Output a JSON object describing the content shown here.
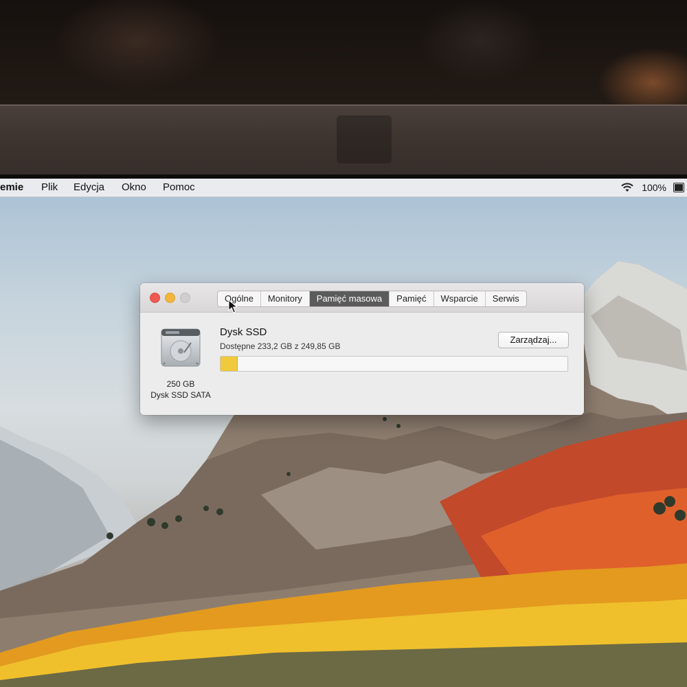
{
  "menubar": {
    "app_name": "emie",
    "items": [
      "Plik",
      "Edycja",
      "Okno",
      "Pomoc"
    ],
    "battery": "100%",
    "wifi_icon": "wifi-icon",
    "battery_icon": "battery-icon"
  },
  "window": {
    "tabs": [
      "Ogólne",
      "Monitory",
      "Pamięć masowa",
      "Pamięć",
      "Wsparcie",
      "Serwis"
    ],
    "active_tab": "Pamięć masowa",
    "disk": {
      "icon": "hard-drive-icon",
      "size_label": "250 GB",
      "type_label": "Dysk SSD SATA",
      "name": "Dysk SSD",
      "available_text": "Dostępne 233,2 GB z 249,85 GB",
      "used_fraction": 0.047,
      "used_color": "#f0c93c"
    },
    "manage_button": "Zarządzaj..."
  }
}
